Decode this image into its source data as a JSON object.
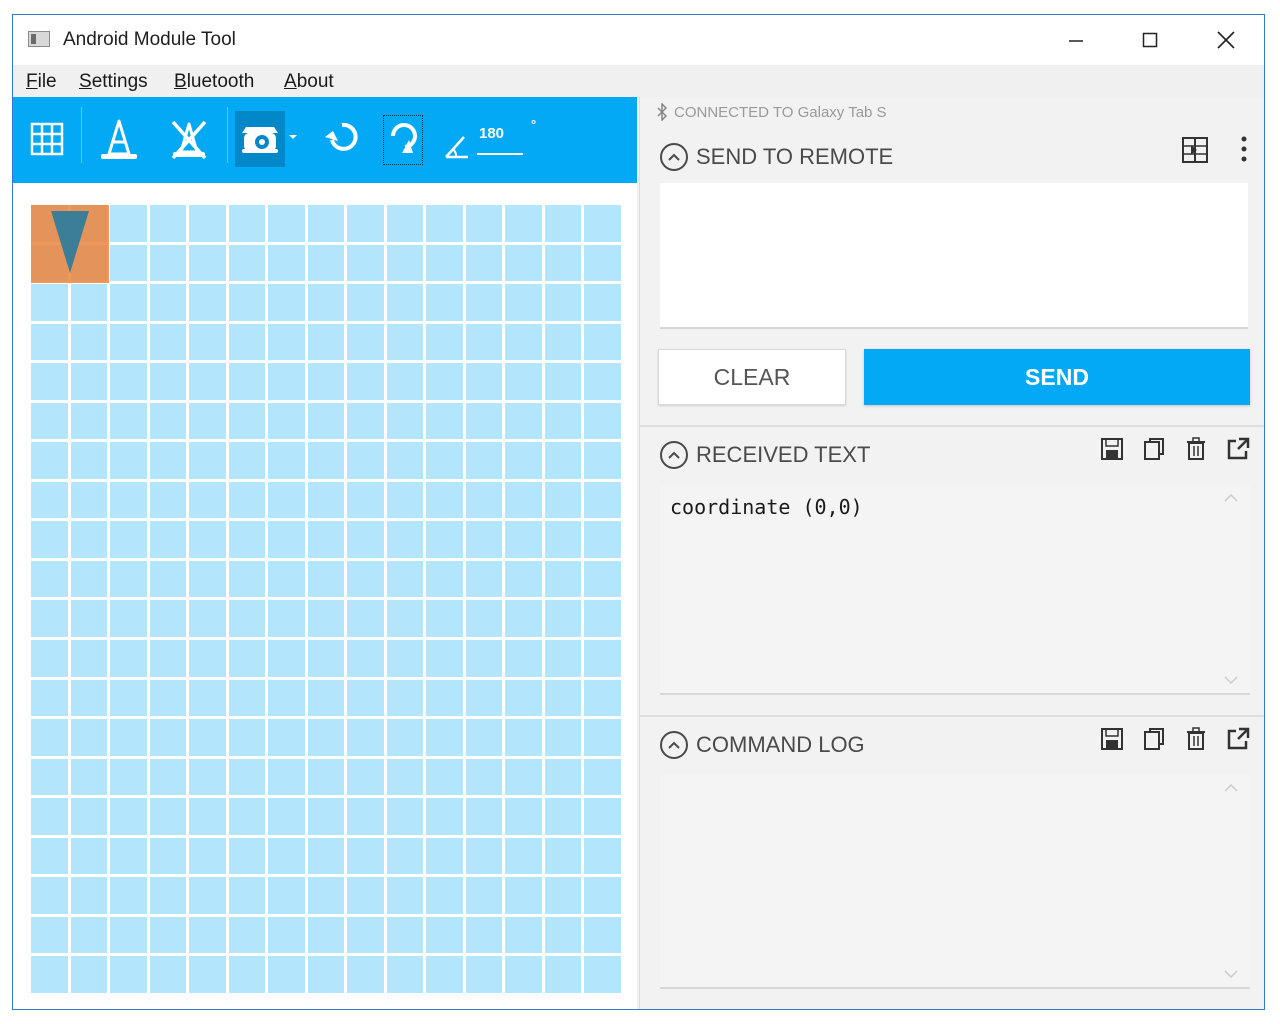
{
  "window": {
    "title": "Android Module Tool"
  },
  "menu": {
    "file": {
      "mnemonic": "F",
      "rest": "ile"
    },
    "settings": {
      "mnemonic": "S",
      "rest": "ettings"
    },
    "bluetooth": {
      "mnemonic": "B",
      "rest": "luetooth"
    },
    "about": {
      "mnemonic": "A",
      "rest": "bout"
    }
  },
  "toolbar": {
    "icons": [
      "grid-icon",
      "cone-icon",
      "remove-obstacle-icon",
      "robot-icon",
      "rotate-left-icon",
      "rotate-right-icon",
      "angle-icon"
    ],
    "angle_value": "180",
    "degree_sign": "°",
    "color": "#03a9f4"
  },
  "grid": {
    "columns": 15,
    "rows": 20,
    "cell_color": "#b3e5fc"
  },
  "robot": {
    "row": 0,
    "col": 0,
    "heading": "down",
    "color": "#ec863e"
  },
  "connection": {
    "status": "CONNECTED TO Galaxy Tab S"
  },
  "send_section": {
    "title": "SEND TO REMOTE",
    "input_value": "",
    "clear_label": "CLEAR",
    "send_label": "SEND"
  },
  "received_section": {
    "title": "RECEIVED TEXT",
    "content": "coordinate (0,0)"
  },
  "command_log_section": {
    "title": "COMMAND LOG",
    "content": ""
  }
}
